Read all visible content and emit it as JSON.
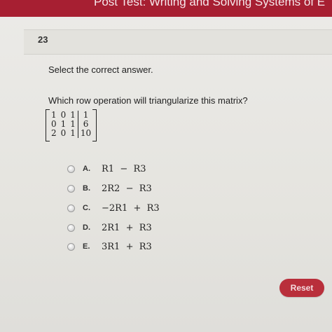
{
  "header": {
    "title": "Post Test: Writing and Solving Systems of E"
  },
  "question": {
    "number": "23",
    "instruction": "Select the correct answer.",
    "prompt": "Which row operation will triangularize this matrix?",
    "matrix": {
      "rows": [
        {
          "c1": "1",
          "c2": "0",
          "c3": "1",
          "aug": "1"
        },
        {
          "c1": "0",
          "c2": "1",
          "c3": "1",
          "aug": "6"
        },
        {
          "c1": "2",
          "c2": "0",
          "c3": "1",
          "aug": "10"
        }
      ]
    }
  },
  "options": [
    {
      "letter": "A.",
      "text": "R1  −  R3"
    },
    {
      "letter": "B.",
      "text": "2R2  −  R3"
    },
    {
      "letter": "C.",
      "text": "−2R1  +  R3"
    },
    {
      "letter": "D.",
      "text": "2R1  +  R3"
    },
    {
      "letter": "E.",
      "text": "3R1  +  R3"
    }
  ],
  "buttons": {
    "reset_label": "Reset"
  },
  "colors": {
    "brand": "#a71f32",
    "reset": "#b92f3b"
  }
}
